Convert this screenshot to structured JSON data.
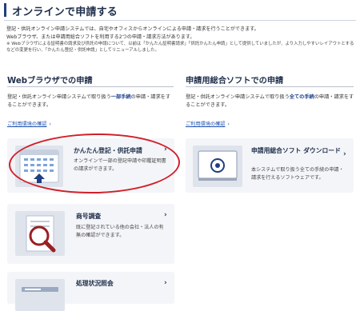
{
  "page": {
    "title": "オンラインで申請する",
    "intro_lines": [
      "登記・供託オンライン申請システムでは、自宅やオフィスからオンラインによる申請・請求を行うことができます。",
      "Webブラウザ、または申請用総合ソフトを利用する2つの申請・請求方法があります。"
    ],
    "note": "※ Webブラウザによる証明書の請求及び供託の申請について、以前は「かんたん証明書請求」「供託かんたん申請」として提供していましたが、より入力しやすいレイアウトとするなどの変更を行い、「かんたん登記・供託申請」としてリニューアルしました。"
  },
  "web": {
    "heading": "Webブラウザでの申請",
    "desc_before": "登記・供託オンライン申請システムで取り扱う",
    "desc_bold": "一部手続",
    "desc_after": "の申請・請求をすることができます。",
    "env_link": "ご利用環境の確認",
    "cards": [
      {
        "title": "かんたん登記・供託申請",
        "desc": "オンラインで一部の登記申請や印鑑証明書の請求ができます。",
        "icon": "browser-form-upload-icon"
      },
      {
        "title": "商号調査",
        "desc": "既に登記されている他の会社・法人の有無の確認ができます。",
        "icon": "magnifier-document-icon"
      },
      {
        "title": "処理状況照会",
        "desc": "",
        "icon": "status-list-icon"
      }
    ]
  },
  "software": {
    "heading": "申請用総合ソフトでの申請",
    "desc_before": "登記・供託オンライン申請システムで取り扱う",
    "desc_bold": "全ての手続",
    "desc_after": "の申請・請求をすることができます。",
    "env_link": "ご利用環境の確認",
    "cards": [
      {
        "title": "申請用総合ソフト ダウンロード",
        "desc": "本システムで取り扱う全ての手続の申請・請求を行えるソフトウェアです。",
        "icon": "pc-download-icon"
      }
    ]
  },
  "colors": {
    "accent": "#1e3f7a",
    "link": "#1a4fb0",
    "highlight": "#d0202a"
  }
}
